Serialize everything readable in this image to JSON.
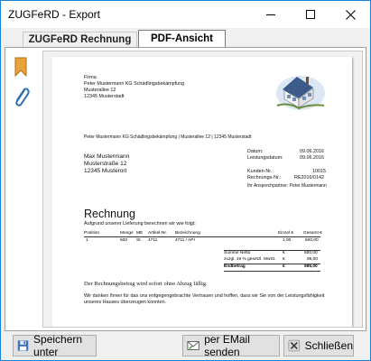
{
  "window": {
    "title": "ZUGFeRD - Export"
  },
  "tabs": [
    {
      "label": "ZUGFeRD Rechnung",
      "active": false
    },
    {
      "label": "PDF-Ansicht",
      "active": true
    }
  ],
  "invoice": {
    "sender_block": [
      "Firma",
      "Peter Mustermann KG Schädlingsbekämpfung",
      "Musterallee 12",
      "12345 Musterstadt"
    ],
    "sender_line": "Peter Mustermann KG Schädlingsbekämpfung | Musterallee 12 | 12345 Musterstadt",
    "recipient": [
      "Max Mustermann",
      "Musterstraße 12",
      "12345 Musterort"
    ],
    "meta": [
      {
        "label": "Datum:",
        "value": "09.06.2016"
      },
      {
        "label": "Leistungsdatum:",
        "value": "09.06.2016"
      },
      {
        "label": "Kunden-Nr.:",
        "value": "10015"
      },
      {
        "label": "Rechnungs-Nr.:",
        "value": "RE2016/0142"
      },
      {
        "label": "Ihr Ansprechpartner: Peter Mustermann",
        "value": ""
      }
    ],
    "heading": "Rechnung",
    "intro": "Aufgrund unserer Lieferung berechnen wir wie folgt:",
    "table_headers": [
      "Position",
      "Menge",
      "ME",
      "Artikel-Nr.",
      "Bezeichnung",
      "Einzel €",
      "Gesamt €"
    ],
    "rows": [
      [
        "1",
        "500",
        "St.",
        "4711",
        "4711 / API",
        "1,00",
        "500,00"
      ]
    ],
    "totals": [
      {
        "label": "Summe Netto",
        "currency": "€",
        "value": "500,00"
      },
      {
        "label": "zuzgl. 19 % gesetzl. MwSt.",
        "currency": "€",
        "value": "95,00"
      },
      {
        "label": "Endbetrag",
        "currency": "€",
        "value": "595,00"
      }
    ],
    "payment_note": "Der Rechnungsbetrag wird sofort ohne Abzug fällig.",
    "thanks": [
      "Wir danken Ihnen für das uns entgegengebrachte Vertrauen und hoffen, dass wir Sie von der Leistungsfähigkeit",
      "unseres Hauses überzeugen konnten."
    ]
  },
  "buttons": {
    "save": "Speichern unter",
    "email": "per EMail senden",
    "close": "Schließen"
  },
  "colors": {
    "accent": "#1883d7",
    "bookmark": "#e8a33b",
    "clip": "#2f6fba"
  }
}
